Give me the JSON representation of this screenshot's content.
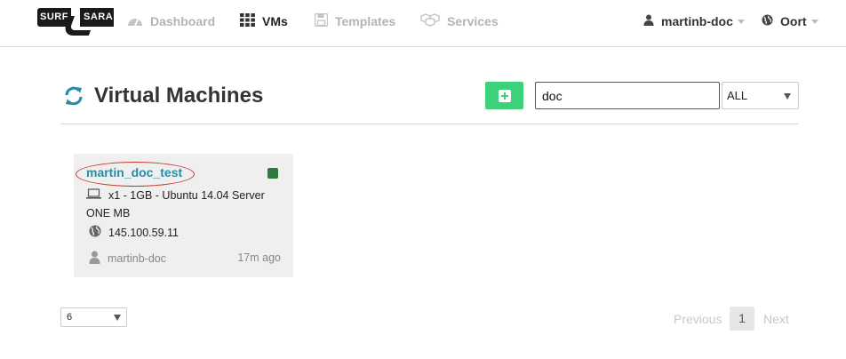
{
  "logo": {
    "left": "SURF",
    "right": "SARA"
  },
  "nav": {
    "items": [
      {
        "label": "Dashboard",
        "icon": "dashboard-icon",
        "active": false
      },
      {
        "label": "VMs",
        "icon": "grid-icon",
        "active": true
      },
      {
        "label": "Templates",
        "icon": "floppy-icon",
        "active": false
      },
      {
        "label": "Services",
        "icon": "cubes-icon",
        "active": false
      }
    ],
    "user": "martinb-doc",
    "org": "Oort"
  },
  "header": {
    "title": "Virtual Machines",
    "search_value": "doc",
    "filter_value": "ALL"
  },
  "vm": {
    "name": "martin_doc_test",
    "spec_line1": "x1 - 1GB - Ubuntu 14.04 Server",
    "spec_line2": "ONE MB",
    "ip": "145.100.59.11",
    "owner": "martinb-doc",
    "age": "17m ago",
    "status_color": "#2e7a3f"
  },
  "footer": {
    "page_size": "6",
    "prev_label": "Previous",
    "current_page": "1",
    "next_label": "Next"
  },
  "colors": {
    "accent": "#2a8da6",
    "add_button": "#3dd17a"
  }
}
